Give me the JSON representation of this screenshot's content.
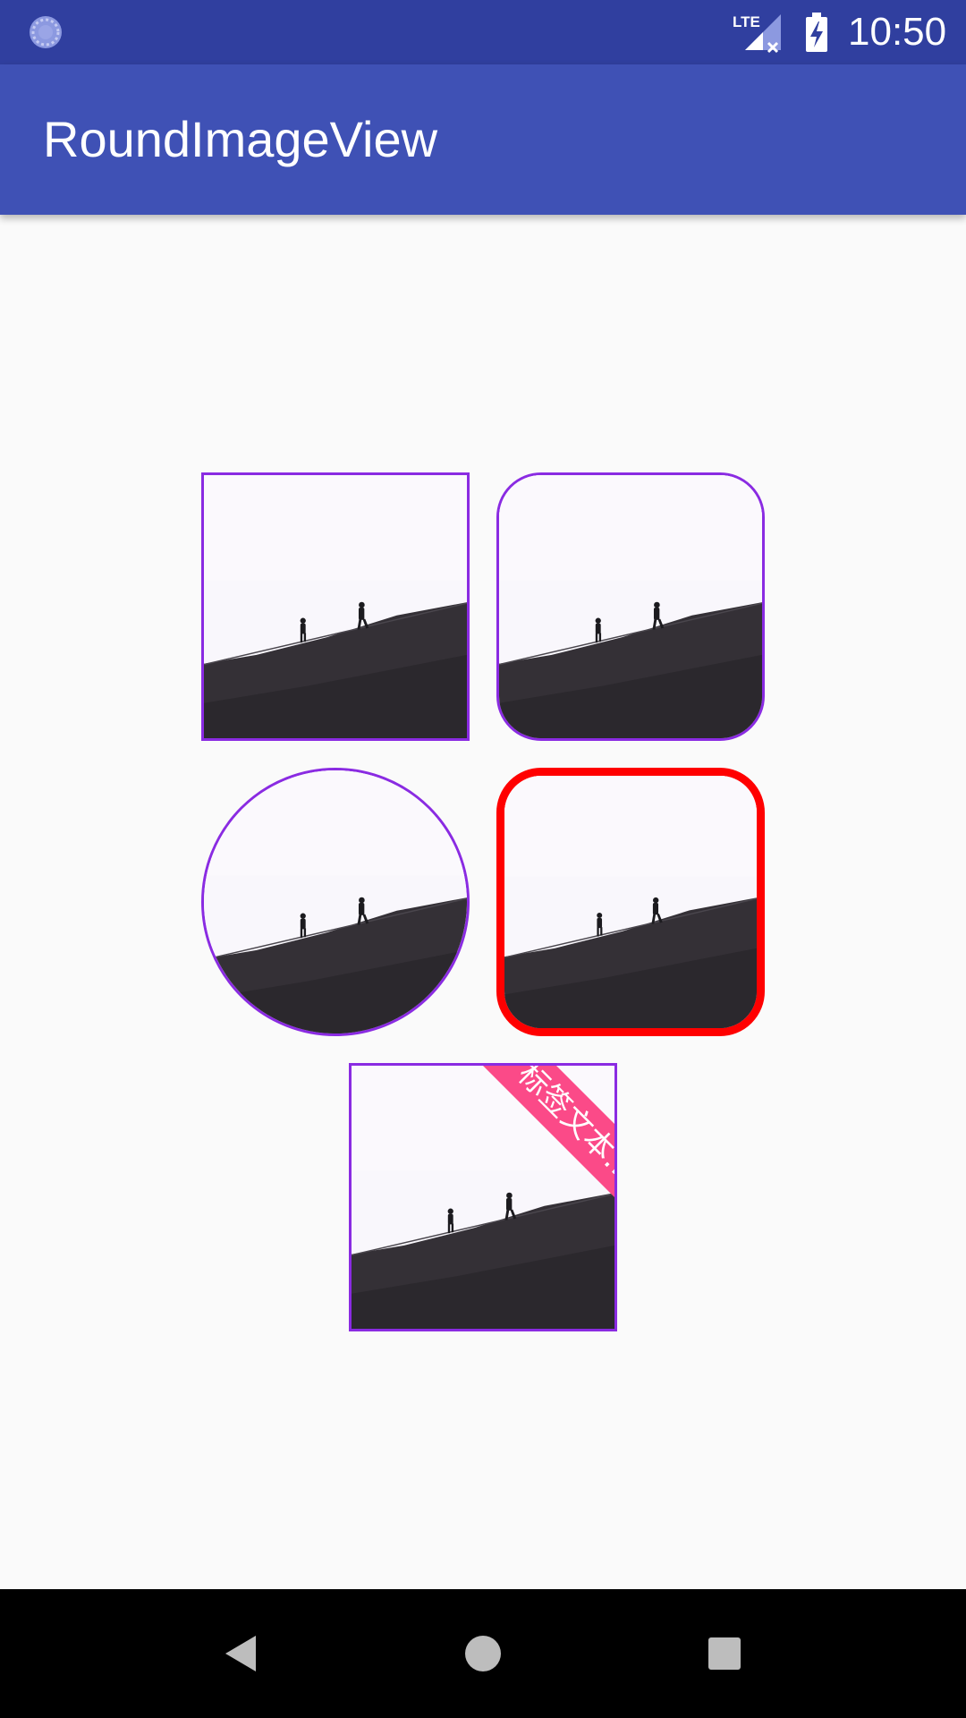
{
  "status_bar": {
    "time": "10:50",
    "network_label": "LTE",
    "icons": [
      "sync-icon",
      "lte-signal-icon",
      "battery-charging-icon"
    ],
    "background_color": "#303f9f"
  },
  "app_bar": {
    "title": "RoundImageView",
    "background_color": "#3f51b5"
  },
  "image_views": [
    {
      "name": "square",
      "border_color": "#8a2be2"
    },
    {
      "name": "rounded-corners",
      "border_color": "#8a2be2"
    },
    {
      "name": "circle",
      "border_color": "#8a2be2"
    },
    {
      "name": "rounded-thick-red-border",
      "border_color": "#ff0000"
    },
    {
      "name": "corner-label",
      "border_color": "#8a2be2",
      "label_text": "标签文本…",
      "label_color": "#fb4a88"
    }
  ],
  "nav_bar": {
    "buttons": [
      "back",
      "home",
      "recents"
    ],
    "icons": [
      "back-triangle-icon",
      "home-circle-icon",
      "recents-square-icon"
    ]
  }
}
